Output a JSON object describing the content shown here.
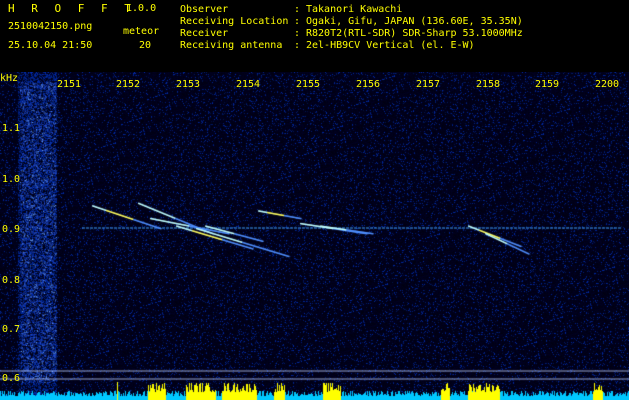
{
  "header": {
    "app_title": "H R O F F T",
    "version": "1.0.0",
    "filename": "2510042150.png",
    "datetime": "25.10.04 21:50",
    "meteor_label": "meteor",
    "meteor_count": "20"
  },
  "info": [
    {
      "key": "Observer",
      "value": "Takanori Kawachi"
    },
    {
      "key": "Receiving Location",
      "value": "Ogaki, Gifu, JAPAN (136.60E, 35.35N)"
    },
    {
      "key": "Receiver",
      "value": "R820T2(RTL-SDR) SDR-Sharp 53.1000MHz"
    },
    {
      "key": "Receiving antenna",
      "value": "2el-HB9CV Vertical (el. E-W)"
    }
  ],
  "info_separator": ":",
  "chart_data": {
    "type": "heatmap",
    "x_unit": "time (HHMM)",
    "y_unit": "kHz",
    "y_unit_label": "kHz",
    "x_ticks": [
      "2151",
      "2152",
      "2153",
      "2154",
      "2155",
      "2156",
      "2157",
      "2158",
      "2159",
      "2200"
    ],
    "y_ticks": [
      "1.1",
      "1.0",
      "0.9",
      "0.8",
      "0.7",
      "0.6"
    ],
    "ylim": [
      0.55,
      1.15
    ],
    "carrier_khz": 0.905,
    "colors": {
      "background": "#000010",
      "noise": "#1030a0",
      "carrier": "#3fa0ff",
      "echo": "#c0ffff",
      "echo_hot": "#ffff60",
      "text": "#ffff00",
      "level_bar": "#00c8ff",
      "level_peak": "#ffff00"
    }
  }
}
